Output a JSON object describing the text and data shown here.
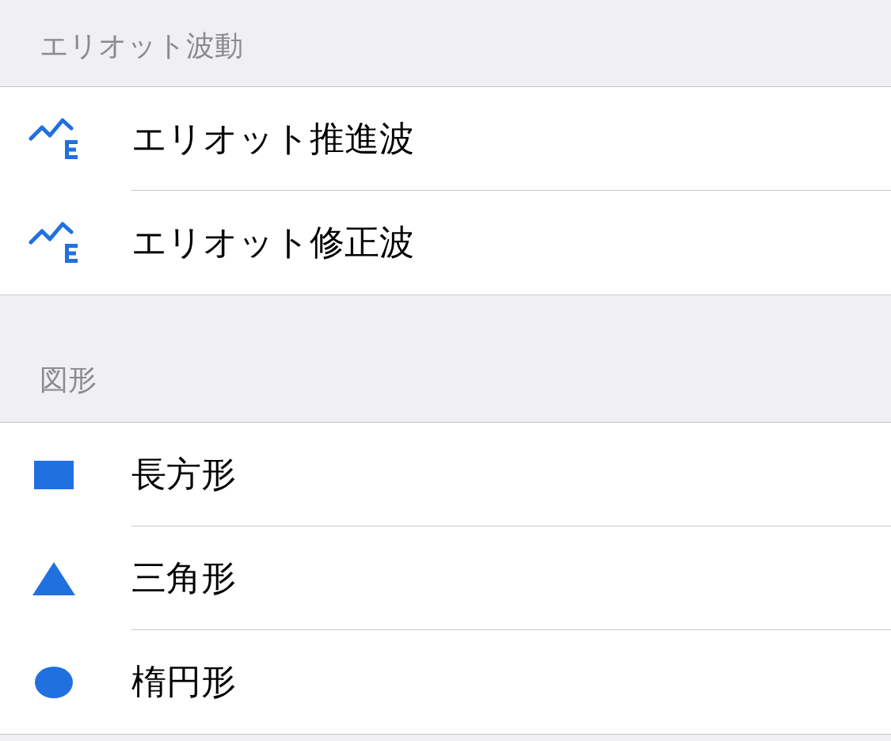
{
  "sections": [
    {
      "title": "エリオット波動",
      "items": [
        {
          "label": "エリオット推進波",
          "kind": "wave"
        },
        {
          "label": "エリオット修正波",
          "kind": "wave"
        }
      ]
    },
    {
      "title": "図形",
      "items": [
        {
          "label": "長方形",
          "kind": "rectangle"
        },
        {
          "label": "三角形",
          "kind": "triangle"
        },
        {
          "label": "楕円形",
          "kind": "ellipse"
        }
      ]
    }
  ]
}
